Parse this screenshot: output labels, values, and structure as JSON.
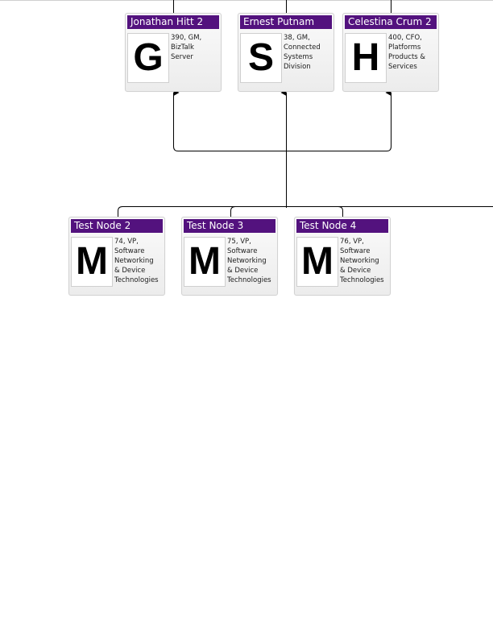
{
  "nodes": {
    "n1": {
      "name": "Jonathan Hitt 2",
      "photo_letter": "G",
      "details": "390, GM,\nBizTalk\nServer"
    },
    "n2": {
      "name": "Ernest Putnam",
      "photo_letter": "S",
      "details": "38, GM,\nConnected\nSystems\nDivision"
    },
    "n3": {
      "name": "Celestina Crum 2",
      "photo_letter": "H",
      "details": "400, CFO,\nPlatforms\nProducts &\nServices"
    },
    "n4": {
      "name": "Test Node 2",
      "photo_letter": "M",
      "details": "74, VP,\nSoftware\nNetworking\n& Device\nTechnologies"
    },
    "n5": {
      "name": "Test Node 3",
      "photo_letter": "M",
      "details": "75, VP,\nSoftware\nNetworking\n& Device\nTechnologies"
    },
    "n6": {
      "name": "Test Node 4",
      "photo_letter": "M",
      "details": "76, VP,\nSoftware\nNetworking\n& Device\nTechnologies"
    }
  },
  "colors": {
    "title_bar": "#53127e",
    "title_text": "#ffffff",
    "connector": "#000000",
    "card_border": "#d2d2d2"
  }
}
